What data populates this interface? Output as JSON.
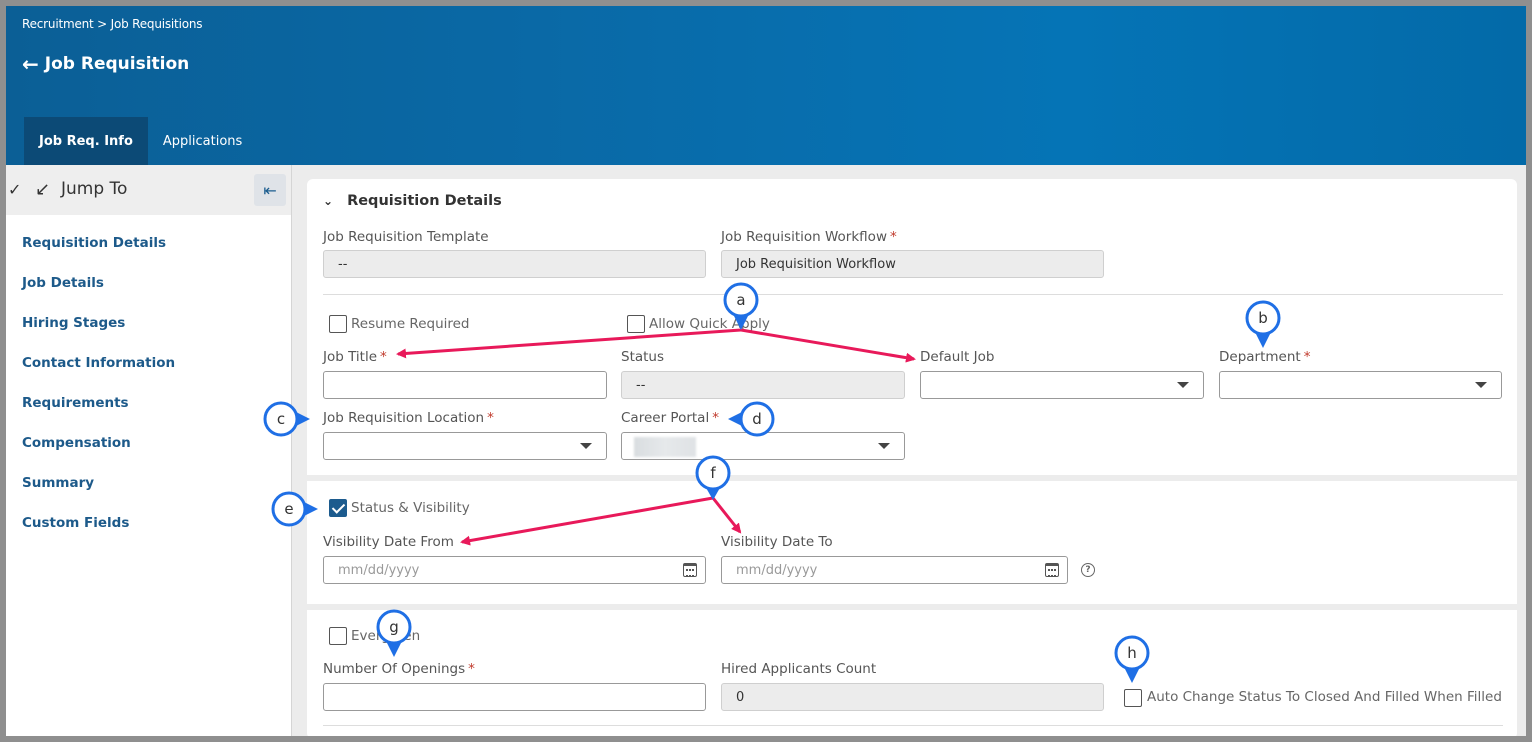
{
  "header": {
    "breadcrumb": "Recruitment > Job Requisitions",
    "title": "Job Requisition",
    "tabs": [
      {
        "label": "Job Req. Info",
        "active": true
      },
      {
        "label": "Applications",
        "active": false
      }
    ]
  },
  "sidebar": {
    "jump_label": "Jump To",
    "items": [
      "Requisition Details",
      "Job Details",
      "Hiring Stages",
      "Contact Information",
      "Requirements",
      "Compensation",
      "Summary",
      "Custom Fields"
    ]
  },
  "section": {
    "title": "Requisition Details",
    "template_label": "Job Requisition Template",
    "template_value": "--",
    "workflow_label": "Job Requisition Workflow",
    "workflow_value": "Job Requisition Workflow",
    "resume_required": "Resume Required",
    "allow_quick_apply": "Allow Quick Apply",
    "job_title_label": "Job Title",
    "status_label": "Status",
    "status_value": "--",
    "default_job_label": "Default Job",
    "department_label": "Department",
    "location_label": "Job Requisition Location",
    "career_portal_label": "Career Portal",
    "status_visibility": "Status & Visibility",
    "status_visibility_checked": true,
    "visibility_from_label": "Visibility Date From",
    "visibility_to_label": "Visibility Date To",
    "date_placeholder": "mm/dd/yyyy",
    "evergreen": "Evergreen",
    "openings_label": "Number Of Openings",
    "hired_label": "Hired Applicants Count",
    "hired_value": "0",
    "auto_close": "Auto Change Status To Closed And Filled When Filled",
    "required_mark": "*"
  },
  "annotations": [
    "a",
    "b",
    "c",
    "d",
    "e",
    "f",
    "g",
    "h"
  ],
  "colors": {
    "header_blue": "#0a69a6",
    "tab_active": "#0c4a76",
    "nav_link": "#1d5a8a",
    "annotation_pin": "#1f6fe5",
    "annotation_arrow": "#e8195a",
    "required": "#c0392b"
  }
}
